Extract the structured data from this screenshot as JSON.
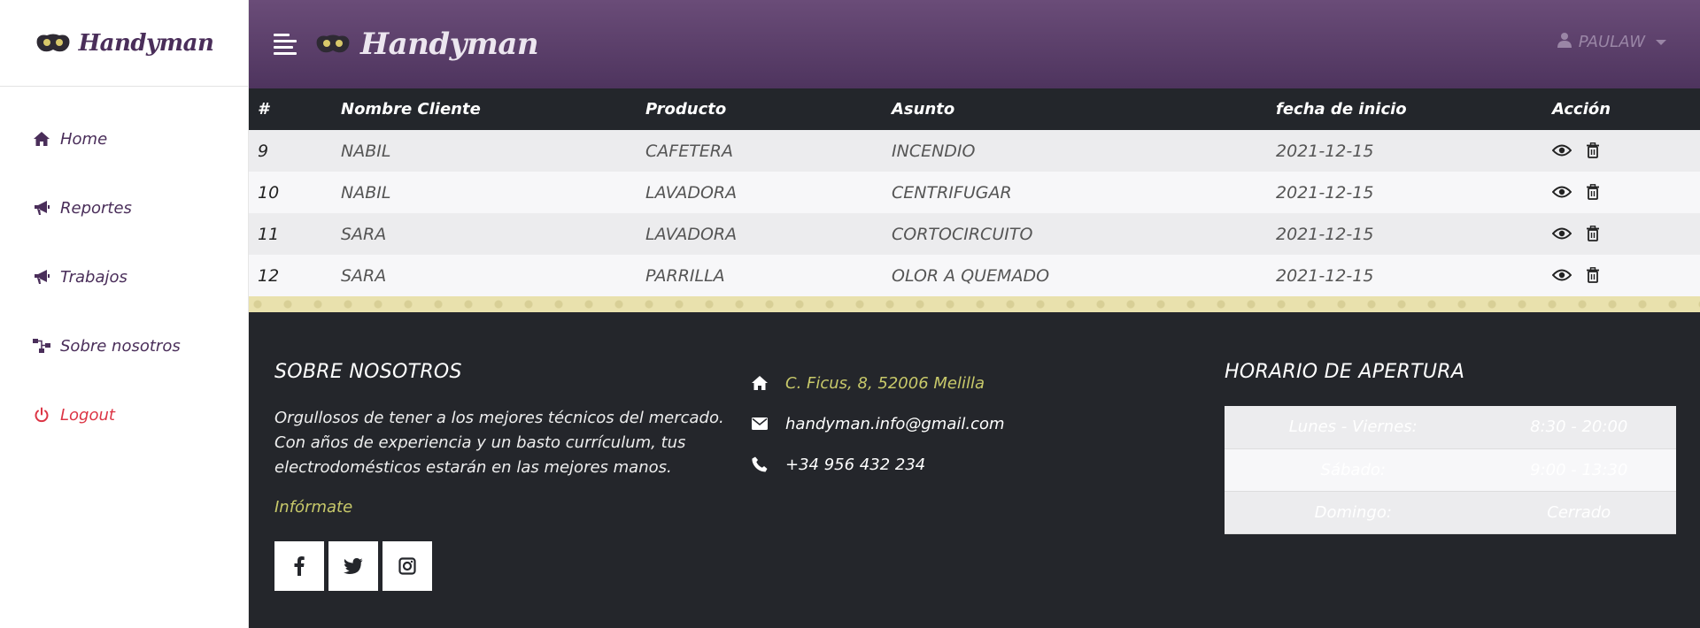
{
  "brand": {
    "name": "Handyman"
  },
  "sidebar": {
    "items": [
      {
        "label": "Home",
        "icon": "home-icon"
      },
      {
        "label": "Reportes",
        "icon": "megaphone-icon"
      },
      {
        "label": "Trabajos",
        "icon": "megaphone-icon"
      },
      {
        "label": "Sobre nosotros",
        "icon": "sitemap-icon"
      },
      {
        "label": "Logout",
        "icon": "power-icon"
      }
    ]
  },
  "header": {
    "user": "PAULAW"
  },
  "table": {
    "columns": [
      "#",
      "Nombre Cliente",
      "Producto",
      "Asunto",
      "fecha de inicio",
      "Acción"
    ],
    "rows": [
      {
        "id": "9",
        "cliente": "NABIL",
        "producto": "CAFETERA",
        "asunto": "INCENDIO",
        "fecha": "2021-12-15"
      },
      {
        "id": "10",
        "cliente": "NABIL",
        "producto": "LAVADORA",
        "asunto": "CENTRIFUGAR",
        "fecha": "2021-12-15"
      },
      {
        "id": "11",
        "cliente": "SARA",
        "producto": "LAVADORA",
        "asunto": "CORTOCIRCUITO",
        "fecha": "2021-12-15"
      },
      {
        "id": "12",
        "cliente": "SARA",
        "producto": "PARRILLA",
        "asunto": "OLOR A QUEMADO",
        "fecha": "2021-12-15"
      }
    ]
  },
  "footer": {
    "about": {
      "title": "SOBRE NOSOTROS",
      "text": "Orgullosos de tener a los mejores técnicos del mercado. Con años de experiencia y un basto currículum, tus electrodomésticos estarán en las mejores manos.",
      "link": "Infórmate"
    },
    "contact": {
      "address": "C. Ficus, 8, 52006 Melilla",
      "email": "handyman.info@gmail.com",
      "phone": "+34 956 432 234"
    },
    "hours": {
      "title": "HORARIO DE APERTURA",
      "rows": [
        {
          "day": "Lunes - Viernes:",
          "time": "8:30 - 20:00"
        },
        {
          "day": "Sábado:",
          "time": "9:00 - 13:30"
        },
        {
          "day": "Domingo:",
          "time": "Cerrado"
        }
      ]
    }
  },
  "colors": {
    "purple": "#4a2e5a",
    "accent": "#c8c96a",
    "danger": "#dc3545",
    "dark": "#24262b"
  }
}
